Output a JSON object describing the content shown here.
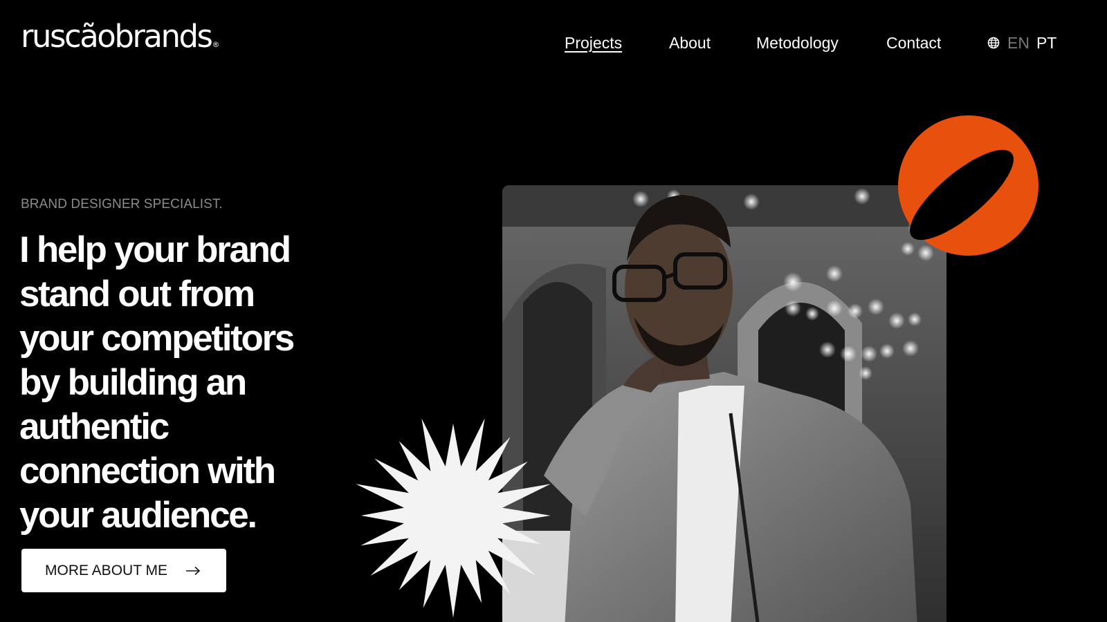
{
  "brand": {
    "logo_text": "ruscãobrands",
    "registered_mark": "®"
  },
  "nav": {
    "items": [
      {
        "label": "Projects",
        "active": true
      },
      {
        "label": "About",
        "active": false
      },
      {
        "label": "Metodology",
        "active": false
      },
      {
        "label": "Contact",
        "active": false
      }
    ],
    "language": {
      "icon": "globe-icon",
      "options": [
        "EN",
        "PT"
      ],
      "selected": "PT"
    }
  },
  "hero": {
    "eyebrow": "BRAND DESIGNER SPECIALIST.",
    "headline_lines": [
      "I help your brand",
      "stand out from",
      "your competitors",
      "by building an",
      "authentic",
      "connection with",
      "your audience."
    ],
    "cta_label": "MORE ABOUT ME",
    "cta_icon": "arrow-right-icon"
  },
  "colors": {
    "background": "#000000",
    "accent_orange": "#E8500E",
    "starburst": "#F2F3F2",
    "muted_text": "#8C8C8C"
  }
}
